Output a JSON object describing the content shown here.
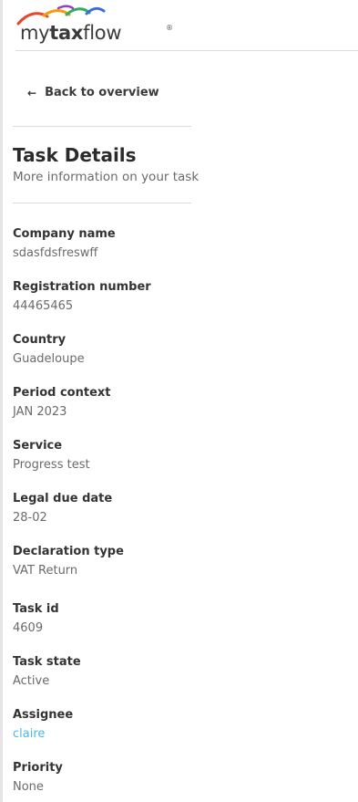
{
  "brand": {
    "name_prefix": "my",
    "name_bold": "tax",
    "name_suffix": "flow",
    "registered_mark": "®"
  },
  "navigation": {
    "back_label": "Back to overview"
  },
  "task_details": {
    "title": "Task Details",
    "subtitle": "More information on your task",
    "fields": [
      {
        "label": "Company name",
        "value": "sdasfdsfreswff"
      },
      {
        "label": "Registration number",
        "value": "44465465"
      },
      {
        "label": "Country",
        "value": "Guadeloupe"
      },
      {
        "label": "Period context",
        "value": "JAN 2023"
      },
      {
        "label": "Service",
        "value": "Progress test"
      },
      {
        "label": "Legal due date",
        "value": "28-02"
      },
      {
        "label": "Declaration type",
        "value": "VAT Return"
      },
      {
        "label": "Task id",
        "value": "4609"
      },
      {
        "label": "Task state",
        "value": "Active"
      },
      {
        "label": "Assignee",
        "value": "claire"
      },
      {
        "label": "Priority",
        "value": "None"
      }
    ]
  },
  "colors": {
    "link": "#4db8e8",
    "text": "#2b2b2b",
    "muted": "#6a6a6a",
    "divider": "#dcdcdc"
  }
}
